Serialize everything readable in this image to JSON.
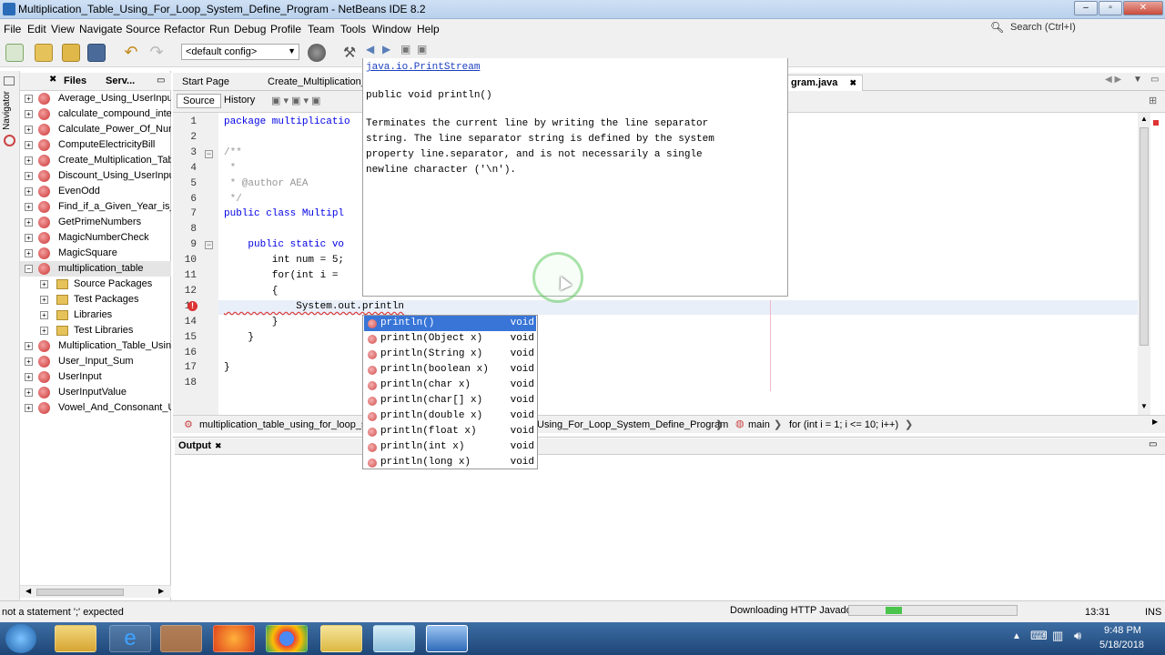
{
  "window": {
    "title": "Multiplication_Table_Using_For_Loop_System_Define_Program - NetBeans IDE 8.2",
    "search_placeholder": "Search (Ctrl+I)"
  },
  "menubar": {
    "items": [
      "File",
      "Edit",
      "View",
      "Navigate",
      "Source",
      "Refactor",
      "Run",
      "Debug",
      "Profile",
      "Team",
      "Tools",
      "Window",
      "Help"
    ]
  },
  "toolbar": {
    "config": "<default config>"
  },
  "sidebar": {
    "navigator_label": "Navigator",
    "tabs": [
      "Files",
      "Serv..."
    ],
    "projects": [
      {
        "label": "Average_Using_UserInput",
        "expanded": false
      },
      {
        "label": "calculate_compound_intere",
        "expanded": false
      },
      {
        "label": "Calculate_Power_Of_Numb",
        "expanded": false
      },
      {
        "label": "ComputeElectricityBill",
        "expanded": false
      },
      {
        "label": "Create_Multiplication_Table",
        "expanded": false
      },
      {
        "label": "Discount_Using_UserInput",
        "expanded": false
      },
      {
        "label": "EvenOdd",
        "expanded": false
      },
      {
        "label": "Find_if_a_Given_Year_is_a",
        "expanded": false
      },
      {
        "label": "GetPrimeNumbers",
        "expanded": false
      },
      {
        "label": "MagicNumberCheck",
        "expanded": false
      },
      {
        "label": "MagicSquare",
        "expanded": false
      },
      {
        "label": "multiplication_table",
        "expanded": true
      },
      {
        "label": "Source Packages",
        "child": true
      },
      {
        "label": "Test Packages",
        "child": true
      },
      {
        "label": "Libraries",
        "child": true
      },
      {
        "label": "Test Libraries",
        "child": true
      },
      {
        "label": "Multiplication_Table_Using_",
        "expanded": false
      },
      {
        "label": "User_Input_Sum",
        "expanded": false
      },
      {
        "label": "UserInput",
        "expanded": false
      },
      {
        "label": "UserInputValue",
        "expanded": false
      },
      {
        "label": "Vowel_And_Consonant_Usi",
        "expanded": false
      }
    ]
  },
  "editor": {
    "tabs": [
      "Start Page",
      "Create_Multiplication_T",
      "gram.java"
    ],
    "source_tab": "Source",
    "history_tab": "History",
    "line_numbers": [
      "1",
      "2",
      "3",
      "4",
      "5",
      "6",
      "7",
      "8",
      "9",
      "10",
      "11",
      "12",
      "13",
      "14",
      "15",
      "16",
      "17",
      "18"
    ],
    "lines": [
      "package multiplicatio",
      "",
      "/**",
      " *",
      " * @author AEA",
      " */",
      "public class Multipl",
      "",
      "    public static vo",
      "        int num = 5;",
      "        for(int i = ",
      "        {",
      "            System.out.println",
      "        }",
      "    }",
      "",
      "}",
      ""
    ],
    "breadcrumb": [
      "multiplication_table_using_for_loop_sys",
      "Using_For_Loop_System_Define_Program",
      "main",
      "for (int i = 1; i <= 10; i++)"
    ]
  },
  "javadoc": {
    "class_link": "java.io.PrintStream",
    "signature": "public void println()",
    "description_lines": [
      "Terminates the current line by writing the line separator",
      "string. The line separator string is defined by the system",
      "property line.separator, and is not necessarily a single",
      "newline character ('\\n')."
    ]
  },
  "completion": {
    "items": [
      {
        "name": "println()",
        "type": "void"
      },
      {
        "name": "println(Object x)",
        "type": "void"
      },
      {
        "name": "println(String x)",
        "type": "void"
      },
      {
        "name": "println(boolean x)",
        "type": "void"
      },
      {
        "name": "println(char x)",
        "type": "void"
      },
      {
        "name": "println(char[] x)",
        "type": "void"
      },
      {
        "name": "println(double x)",
        "type": "void"
      },
      {
        "name": "println(float x)",
        "type": "void"
      },
      {
        "name": "println(int x)",
        "type": "void"
      },
      {
        "name": "println(long x)",
        "type": "void"
      }
    ]
  },
  "output": {
    "title": "Output"
  },
  "statusbar": {
    "message": "not a statement  ';' expected",
    "download_text": "Downloading HTTP Javadoc",
    "progress_fraction": 0.1,
    "position": "13:31",
    "mode": "INS"
  },
  "taskbar": {
    "time": "9:48 PM",
    "date": "5/18/2018"
  }
}
